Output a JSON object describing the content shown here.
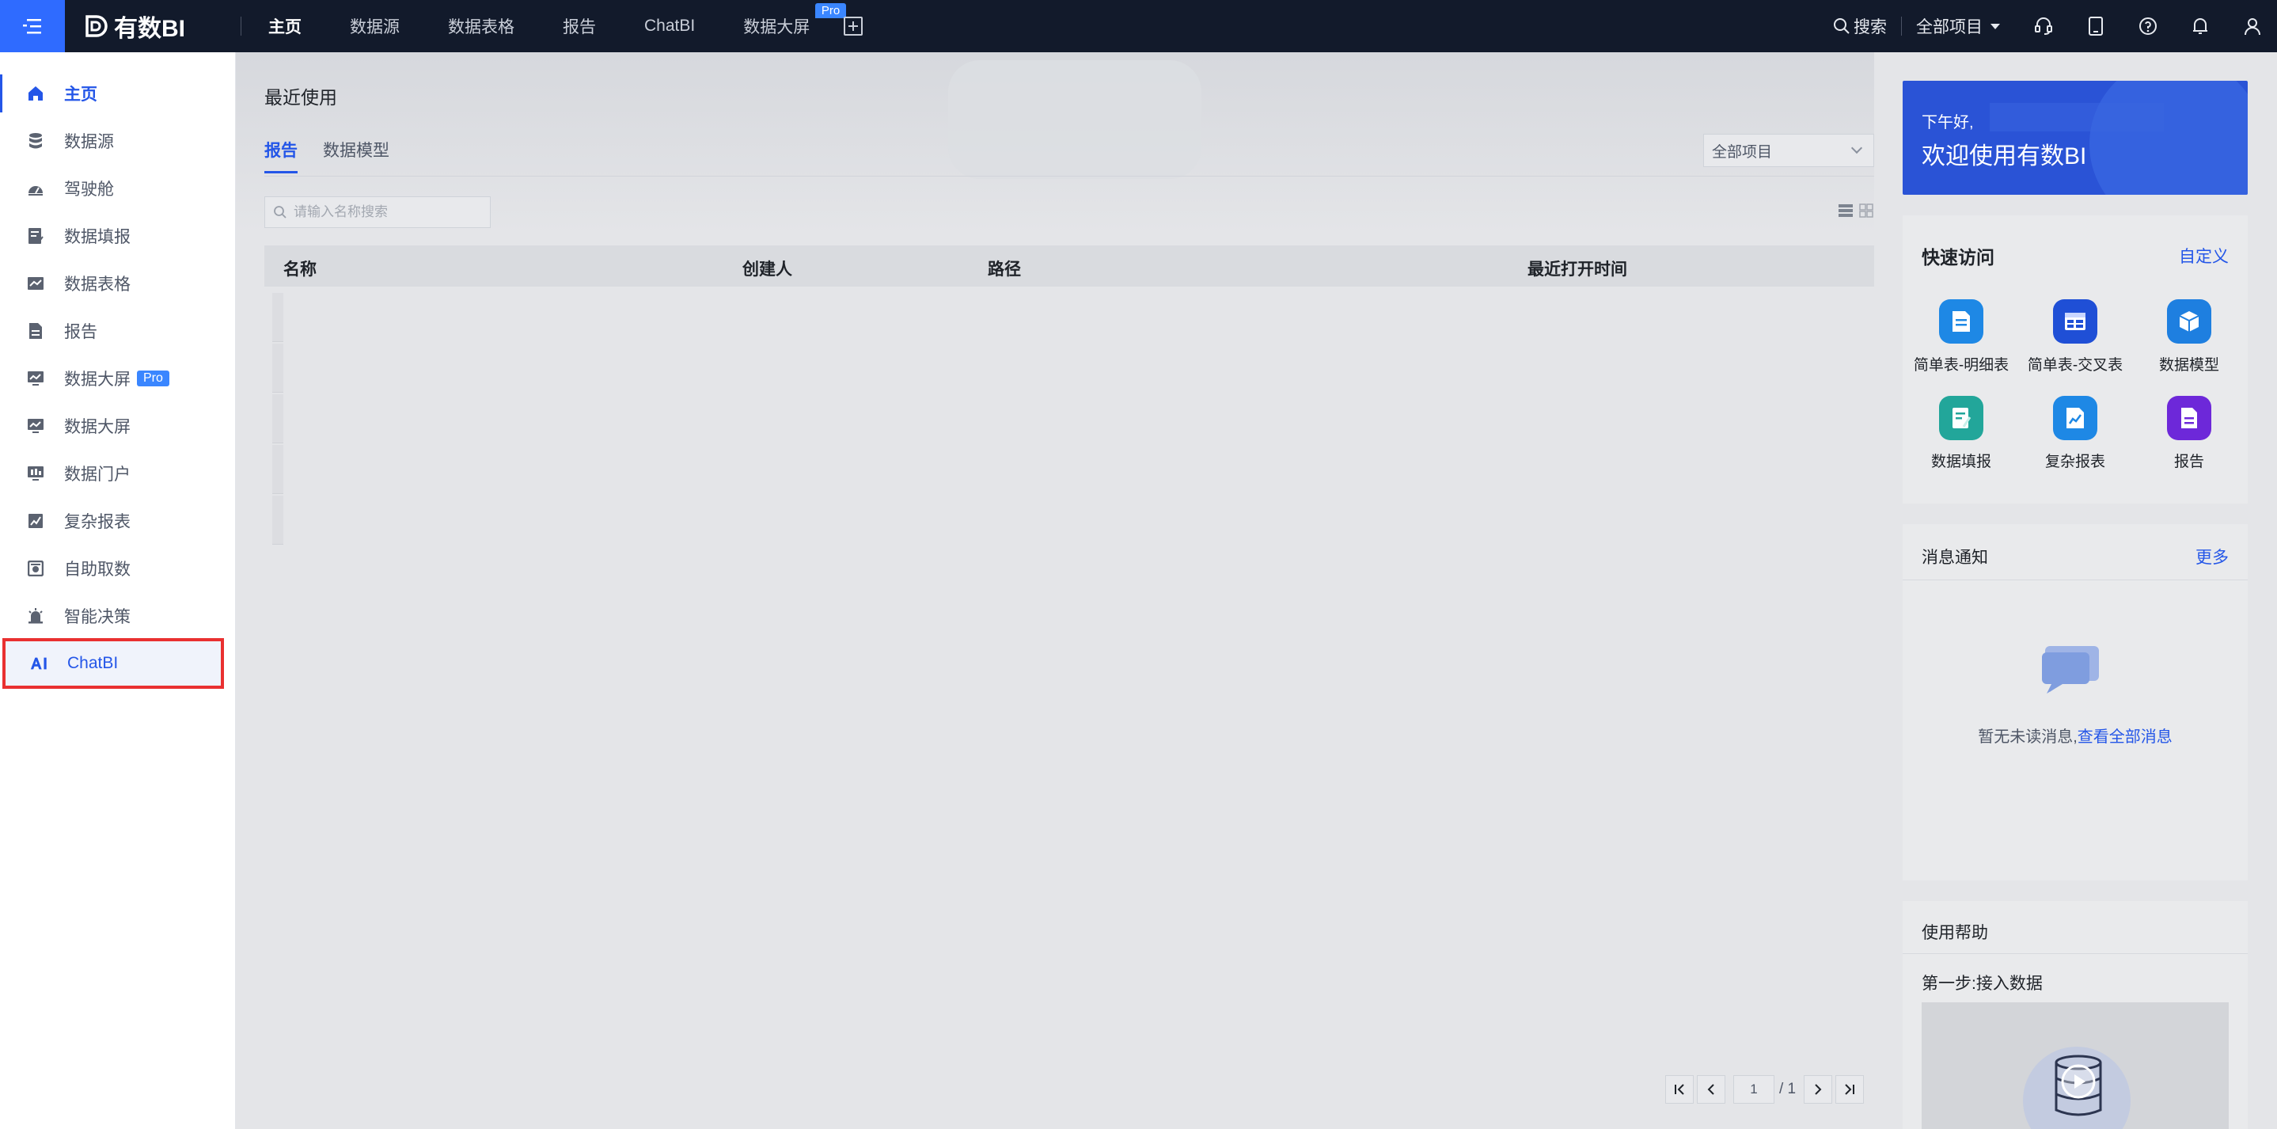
{
  "app": {
    "logo_text": "有数BI"
  },
  "topnav": {
    "items": [
      {
        "label": "主页",
        "active": true
      },
      {
        "label": "数据源"
      },
      {
        "label": "数据表格"
      },
      {
        "label": "报告"
      },
      {
        "label": "ChatBI"
      },
      {
        "label": "数据大屏"
      }
    ],
    "pro_badge": "Pro",
    "search_label": "搜索",
    "project_label": "全部项目"
  },
  "sidebar": {
    "items": [
      {
        "label": "主页",
        "icon": "home-icon",
        "active": true
      },
      {
        "label": "数据源",
        "icon": "database-icon"
      },
      {
        "label": "驾驶舱",
        "icon": "dashboard-icon"
      },
      {
        "label": "数据填报",
        "icon": "form-icon"
      },
      {
        "label": "数据表格",
        "icon": "table-icon"
      },
      {
        "label": "报告",
        "icon": "report-icon"
      },
      {
        "label": "数据大屏",
        "icon": "screen-icon",
        "badge": "Pro"
      },
      {
        "label": "数据大屏",
        "icon": "screen-icon"
      },
      {
        "label": "数据门户",
        "icon": "portal-icon"
      },
      {
        "label": "复杂报表",
        "icon": "chart-icon"
      },
      {
        "label": "自助取数",
        "icon": "fetch-icon"
      },
      {
        "label": "智能决策",
        "icon": "decision-icon"
      },
      {
        "label": "ChatBI",
        "icon": "ai-icon",
        "highlighted": true
      }
    ]
  },
  "main": {
    "section_title": "最近使用",
    "tabs": [
      {
        "label": "报告",
        "active": true
      },
      {
        "label": "数据模型"
      }
    ],
    "project_filter": "全部项目",
    "search_placeholder": "请输入名称搜索",
    "columns": [
      "名称",
      "创建人",
      "路径",
      "最近打开时间"
    ],
    "pagination": {
      "current": "1",
      "total": "/ 1"
    }
  },
  "right": {
    "welcome": {
      "greeting": "下午好,",
      "title": "欢迎使用有数BI"
    },
    "quick_access": {
      "title": "快速访问",
      "customize": "自定义",
      "items": [
        {
          "label": "简单表-明细表",
          "icon": "detail-table-icon",
          "color": "#1e88e5"
        },
        {
          "label": "简单表-交叉表",
          "icon": "cross-table-icon",
          "color": "#1f4fd6"
        },
        {
          "label": "数据模型",
          "icon": "cube-icon",
          "color": "#1e7fe0"
        },
        {
          "label": "数据填报",
          "icon": "form-icon",
          "color": "#22a69a"
        },
        {
          "label": "复杂报表",
          "icon": "complex-report-icon",
          "color": "#1e88e5"
        },
        {
          "label": "报告",
          "icon": "report-icon",
          "color": "#6d28d9"
        }
      ]
    },
    "messages": {
      "title": "消息通知",
      "more": "更多",
      "empty_text": "暂无未读消息,",
      "view_all": "查看全部消息"
    },
    "help": {
      "title": "使用帮助",
      "step1": "第一步:接入数据"
    }
  },
  "colors": {
    "accent": "#2456e8",
    "topbar": "#121a2b",
    "highlight": "#e93030"
  }
}
